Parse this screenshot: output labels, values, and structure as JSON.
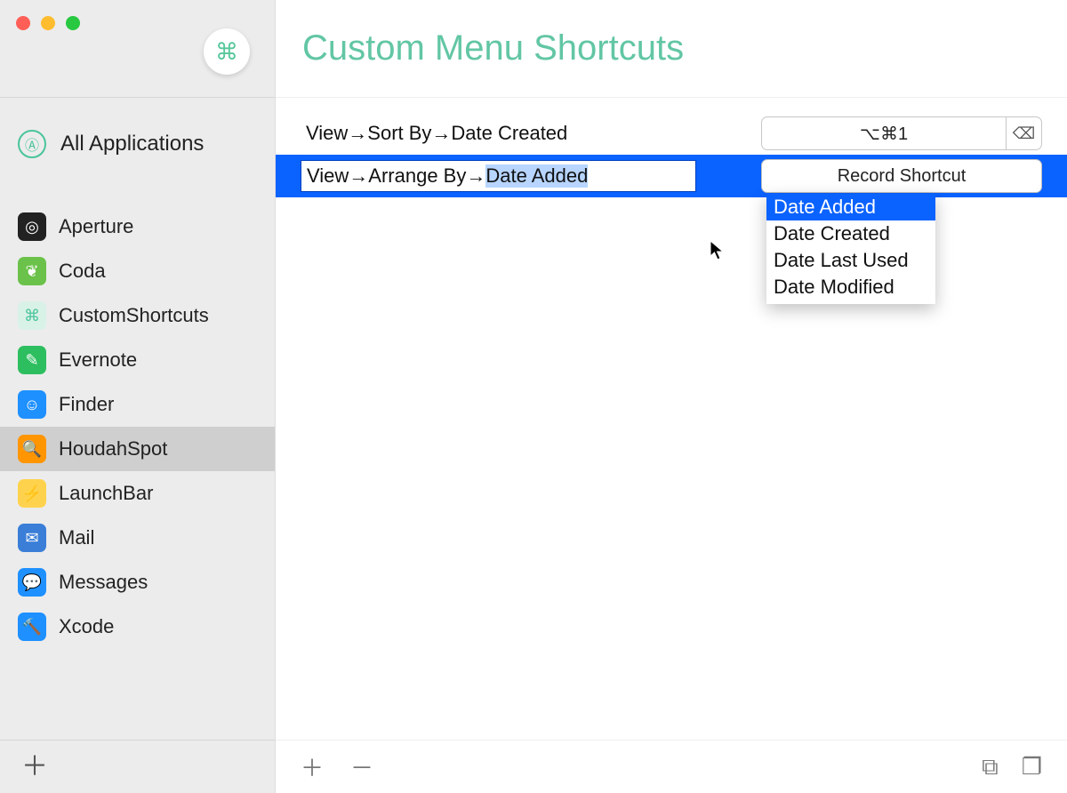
{
  "header": {
    "title": "Custom Menu Shortcuts"
  },
  "sidebar": {
    "all_apps_label": "All Applications",
    "apps": [
      {
        "name": "Aperture",
        "icon_bg": "#222",
        "icon_glyph": "◎"
      },
      {
        "name": "Coda",
        "icon_bg": "#6bc24a",
        "icon_glyph": "❦"
      },
      {
        "name": "CustomShortcuts",
        "icon_bg": "#d9f2e8",
        "icon_glyph": "⌘",
        "glyph_color": "#4ac49b"
      },
      {
        "name": "Evernote",
        "icon_bg": "#2dbe60",
        "icon_glyph": "✎"
      },
      {
        "name": "Finder",
        "icon_bg": "#1e90ff",
        "icon_glyph": "☺"
      },
      {
        "name": "HoudahSpot",
        "icon_bg": "#ff9500",
        "icon_glyph": "🔍",
        "selected": true
      },
      {
        "name": "LaunchBar",
        "icon_bg": "#ffd24d",
        "icon_glyph": "⚡",
        "glyph_color": "#c06500"
      },
      {
        "name": "Mail",
        "icon_bg": "#3a7ed8",
        "icon_glyph": "✉"
      },
      {
        "name": "Messages",
        "icon_bg": "#1e90ff",
        "icon_glyph": "💬"
      },
      {
        "name": "Xcode",
        "icon_bg": "#1e90ff",
        "icon_glyph": "🔨"
      }
    ]
  },
  "shortcuts": {
    "rows": [
      {
        "menu_path": "View→Sort By→Date Created",
        "shortcut_display": "⌥⌘1",
        "has_shortcut": true
      },
      {
        "menu_path_prefix": "View→Arrange By→",
        "menu_path_suffix": "Date Added",
        "record_label": "Record Shortcut",
        "selected": true,
        "editing": true
      }
    ]
  },
  "autocomplete": {
    "items": [
      "Date Added",
      "Date Created",
      "Date Last Used",
      "Date Modified"
    ],
    "highlighted_index": 0
  },
  "icons": {
    "cmd": "⌘",
    "appstore": "Ⓐ",
    "plus": "＋",
    "minus": "－",
    "delete_back": "⌫",
    "window_copy": "⧉",
    "window_dup": "❐"
  }
}
